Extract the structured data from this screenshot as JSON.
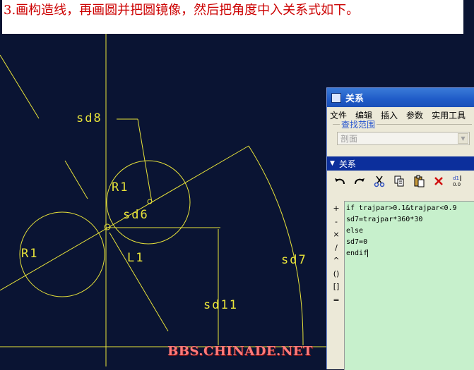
{
  "caption": "3.画构造线，再画圆并把圆镜像，然后把角度中入关系式如下。",
  "dimensions": {
    "sd8": "sd8",
    "sd6": "sd6",
    "sd7": "sd7",
    "sd11": "sd11",
    "r1_top": "R1",
    "r1_left": "R1",
    "l1": "L1"
  },
  "watermark": "BBS.CHINADE.NET",
  "dialog": {
    "title": "关系",
    "menu": [
      "文件",
      "编辑",
      "插入",
      "参数",
      "实用工具"
    ],
    "search_group_label": "查找范围",
    "search_scope_value": "剖面",
    "section_label": "关系",
    "toolbar_icons": [
      "undo-icon",
      "redo-icon",
      "cut-icon",
      "copy-icon",
      "paste-icon",
      "delete-icon",
      "switch-dimension-icon"
    ],
    "operators": [
      "+",
      "-",
      "×",
      "/",
      "^",
      "()",
      "[]",
      "="
    ],
    "relations": [
      "if trajpar>0.1&trajpar<0.9",
      "sd7=trajpar*360*30",
      "else",
      "sd7=0",
      "endif"
    ]
  },
  "colors": {
    "background": "#0a1433",
    "sketch": "#e8e33a",
    "caption_text": "#cc0000",
    "editor_bg": "#c7f0cc",
    "titlebar": "#1f5bc7"
  }
}
